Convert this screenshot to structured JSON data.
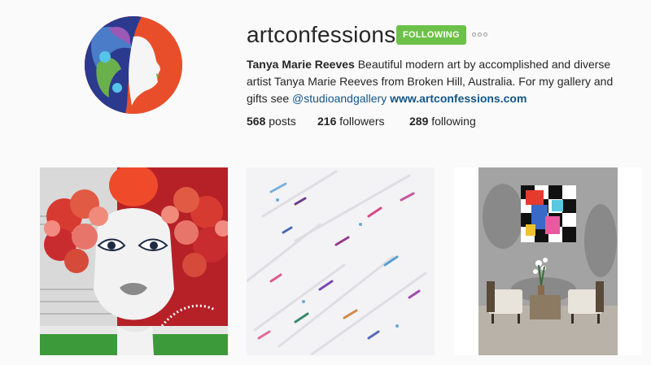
{
  "profile": {
    "username": "artconfessions",
    "follow_label": "FOLLOWING",
    "bio_name": "Tanya Marie Reeves",
    "bio_text": " Beautiful modern art by accomplished and diverse artist Tanya Marie Reeves from Broken Hill, Australia. For my gallery and gifts see ",
    "bio_mention": "@studioandgallery",
    "bio_url": "www.artconfessions.com",
    "avatar_icon": "artwork-avatar"
  },
  "stats": {
    "posts_count": "568",
    "posts_label": " posts",
    "followers_count": "216",
    "followers_label": " followers",
    "following_count": "289",
    "following_label": " following"
  },
  "posts": [
    {
      "name": "red-hair-woman-painting"
    },
    {
      "name": "white-abstract-splatter-painting"
    },
    {
      "name": "gallery-room-photo"
    }
  ],
  "colors": {
    "follow_button": "#6cc149",
    "link": "#125688",
    "avatar_bg": "#e94e2b"
  }
}
